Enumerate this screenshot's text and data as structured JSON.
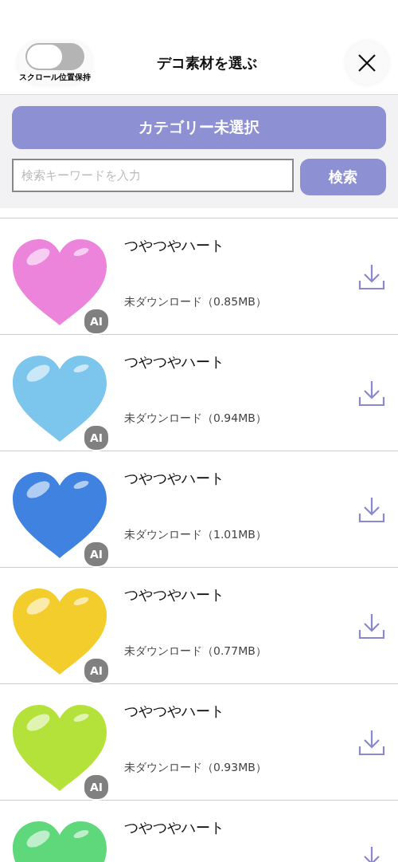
{
  "header": {
    "toggle": {
      "label": "スクロール位置保持",
      "on": false
    },
    "title": "デコ素材を選ぶ"
  },
  "filter": {
    "category_button": "カテゴリー未選択",
    "search": {
      "placeholder": "検索キーワードを入力",
      "button": "検索"
    }
  },
  "items": [
    {
      "title": "つやつやハート",
      "color": "#ec84dc",
      "badge": "AI",
      "status": "未ダウンロード（0.85MB）"
    },
    {
      "title": "つやつやハート",
      "color": "#7cc6ee",
      "badge": "AI",
      "status": "未ダウンロード（0.94MB）"
    },
    {
      "title": "つやつやハート",
      "color": "#3f82e0",
      "badge": "AI",
      "status": "未ダウンロード（1.01MB）"
    },
    {
      "title": "つやつやハート",
      "color": "#f2cd2c",
      "badge": "AI",
      "status": "未ダウンロード（0.77MB）"
    },
    {
      "title": "つやつやハート",
      "color": "#b4e23a",
      "badge": "AI",
      "status": "未ダウンロード（0.93MB）"
    },
    {
      "title": "つやつやハート",
      "color": "#5ed87a"
    }
  ]
}
